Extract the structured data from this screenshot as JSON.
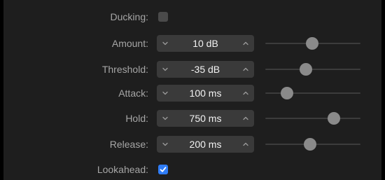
{
  "ducking": {
    "label": "Ducking:",
    "checked": false
  },
  "rows": [
    {
      "label": "Amount:",
      "value": "10 dB",
      "slider": 0.49
    },
    {
      "label": "Threshold:",
      "value": "-35 dB",
      "slider": 0.43
    },
    {
      "label": "Attack:",
      "value": "100 ms",
      "slider": 0.23
    },
    {
      "label": "Hold:",
      "value": "750 ms",
      "slider": 0.72
    },
    {
      "label": "Release:",
      "value": "200 ms",
      "slider": 0.47
    }
  ],
  "lookahead": {
    "label": "Lookahead:",
    "checked": true
  },
  "colors": {
    "background": "#1e1e1e",
    "accent": "#2f7cf6",
    "stepper": "#3a3a3a",
    "thumb": "#8a8a8a"
  }
}
